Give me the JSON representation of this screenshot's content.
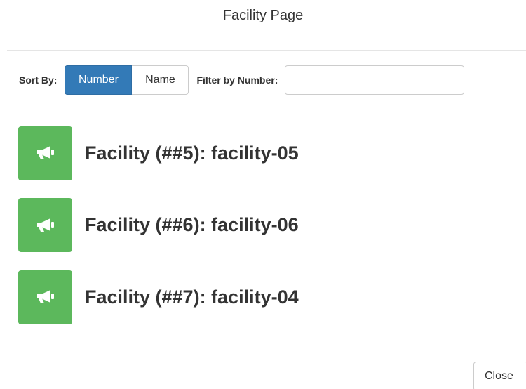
{
  "modal": {
    "title": "Facility Page",
    "close_label": "Close"
  },
  "toolbar": {
    "sort_label": "Sort By:",
    "sort_options": [
      {
        "label": "Number",
        "active": true
      },
      {
        "label": "Name",
        "active": false
      }
    ],
    "filter_label": "Filter by Number:",
    "filter_value": "",
    "filter_placeholder": ""
  },
  "facilities": [
    {
      "label": "Facility (##5): facility-05",
      "icon": "bullhorn-icon"
    },
    {
      "label": "Facility (##6): facility-06",
      "icon": "bullhorn-icon"
    },
    {
      "label": "Facility (##7): facility-04",
      "icon": "bullhorn-icon"
    }
  ],
  "colors": {
    "primary": "#337ab7",
    "success": "#5cb85c",
    "text": "#333333",
    "border": "#cccccc",
    "divider": "#e5e5e5"
  }
}
